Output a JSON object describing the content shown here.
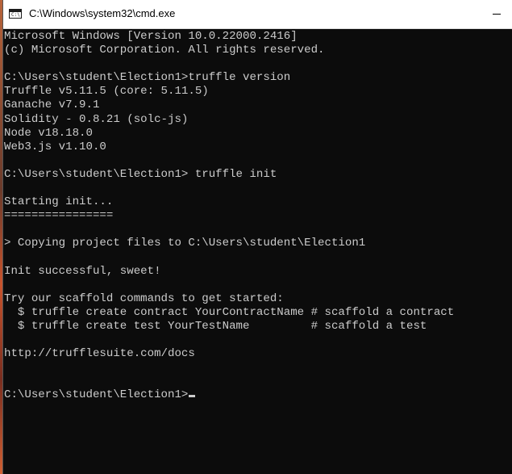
{
  "window": {
    "title": "C:\\Windows\\system32\\cmd.exe",
    "icon": "cmd-icon",
    "background": "#0c0c0c",
    "foreground": "#cccccc"
  },
  "console": {
    "lines": [
      "Microsoft Windows [Version 10.0.22000.2416]",
      "(c) Microsoft Corporation. All rights reserved.",
      "",
      "C:\\Users\\student\\Election1>truffle version",
      "Truffle v5.11.5 (core: 5.11.5)",
      "Ganache v7.9.1",
      "Solidity - 0.8.21 (solc-js)",
      "Node v18.18.0",
      "Web3.js v1.10.0",
      "",
      "C:\\Users\\student\\Election1> truffle init",
      "",
      "Starting init...",
      "================",
      "",
      "> Copying project files to C:\\Users\\student\\Election1",
      "",
      "Init successful, sweet!",
      "",
      "Try our scaffold commands to get started:",
      "  $ truffle create contract YourContractName # scaffold a contract",
      "  $ truffle create test YourTestName         # scaffold a test",
      "",
      "http://trufflesuite.com/docs",
      "",
      "",
      "C:\\Users\\student\\Election1>"
    ]
  }
}
